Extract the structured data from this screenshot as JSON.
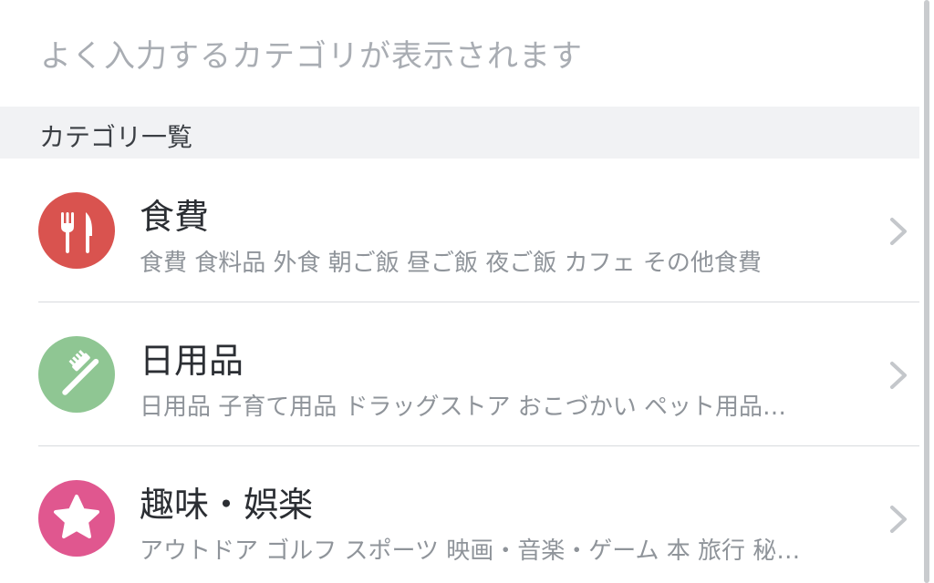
{
  "hint": "よく入力するカテゴリが表示されます",
  "section_title": "カテゴリ一覧",
  "categories": [
    {
      "title": "食費",
      "subcategories": "食費 食料品 外食 朝ご飯 昼ご飯 夜ご飯 カフェ その他食費",
      "icon": "fork-knife-icon",
      "color": "#d9534f"
    },
    {
      "title": "日用品",
      "subcategories": "日用品 子育て用品 ドラッグストア おこづかい ペット用品…",
      "icon": "toothbrush-icon",
      "color": "#8fc693"
    },
    {
      "title": "趣味・娯楽",
      "subcategories": "アウトドア ゴルフ スポーツ 映画・音楽・ゲーム 本 旅行 秘…",
      "icon": "star-icon",
      "color": "#e0578f"
    }
  ]
}
